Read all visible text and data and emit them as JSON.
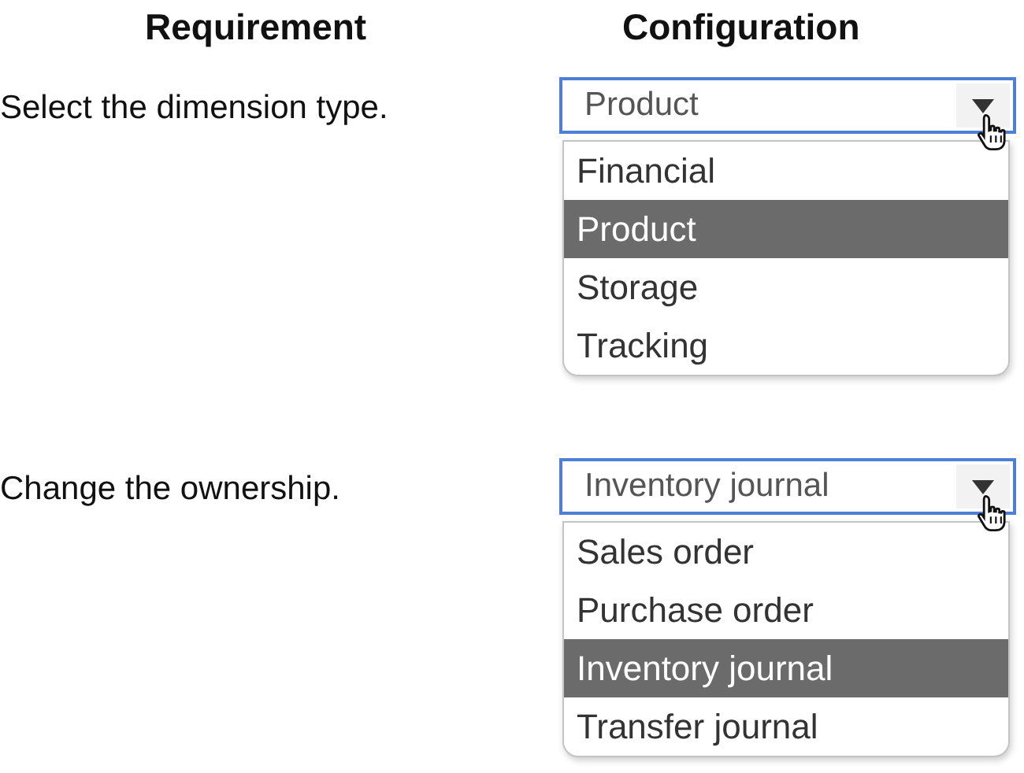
{
  "headers": [
    "Requirement",
    "Configuration"
  ],
  "rows": [
    {
      "requirement": "Select the dimension type.",
      "dropdown": {
        "value": "Product",
        "options": [
          {
            "label": "Financial",
            "selected": false
          },
          {
            "label": "Product",
            "selected": true
          },
          {
            "label": "Storage",
            "selected": false
          },
          {
            "label": "Tracking",
            "selected": false
          }
        ]
      }
    },
    {
      "requirement": "Change the ownership.",
      "dropdown": {
        "value": "Inventory journal",
        "options": [
          {
            "label": "Sales order",
            "selected": false
          },
          {
            "label": "Purchase order",
            "selected": false
          },
          {
            "label": "Inventory journal",
            "selected": true
          },
          {
            "label": "Transfer journal",
            "selected": false
          }
        ]
      }
    }
  ]
}
